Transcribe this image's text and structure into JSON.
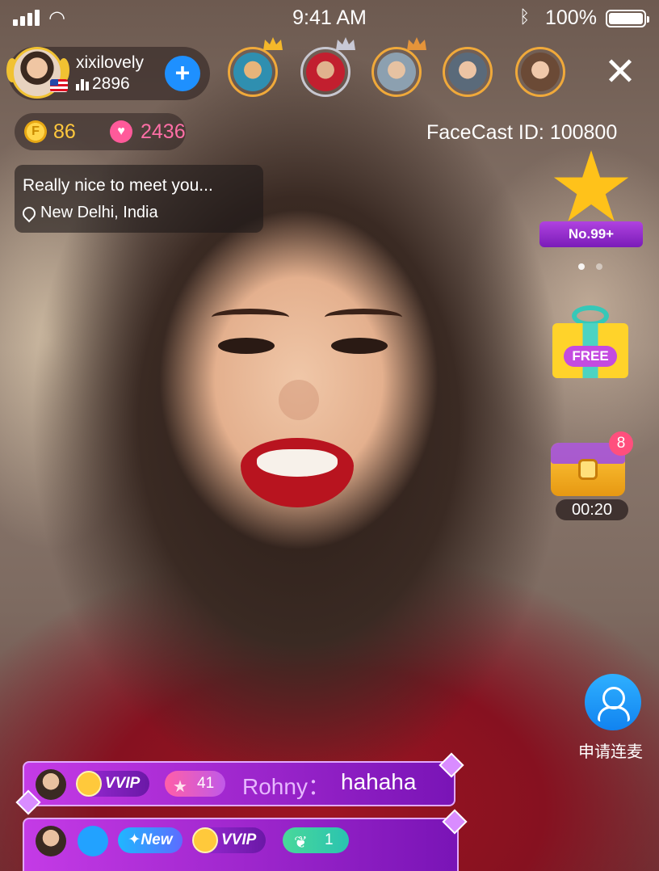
{
  "status_bar": {
    "time": "9:41 AM",
    "battery": "100%"
  },
  "host": {
    "name": "xixilovely",
    "viewers": "2896",
    "follow_label": "+"
  },
  "stats": {
    "coins": "86",
    "hearts": "2436"
  },
  "facecast_id": "FaceCast ID: 100800",
  "intro": {
    "text": "Really nice to meet you...",
    "location": "New Delhi, India"
  },
  "rank": {
    "label": "No.99+"
  },
  "gift": {
    "label": "FREE"
  },
  "chest": {
    "badge": "8",
    "timer": "00:20"
  },
  "cohost": {
    "label": "申请连麦"
  },
  "chat": [
    {
      "badge": "VVIP",
      "level": "41",
      "user": "Rohny：",
      "text": "hahaha"
    },
    {
      "new_badge": "✦New",
      "badge": "VVIP",
      "sprout": "1"
    }
  ],
  "icons": [
    "signal-icon",
    "wifi-icon",
    "bluetooth-icon",
    "battery-icon",
    "coin-icon",
    "heart-icon",
    "location-pin-icon",
    "star-icon",
    "gift-icon",
    "chest-icon",
    "cohost-icon",
    "close-icon"
  ]
}
